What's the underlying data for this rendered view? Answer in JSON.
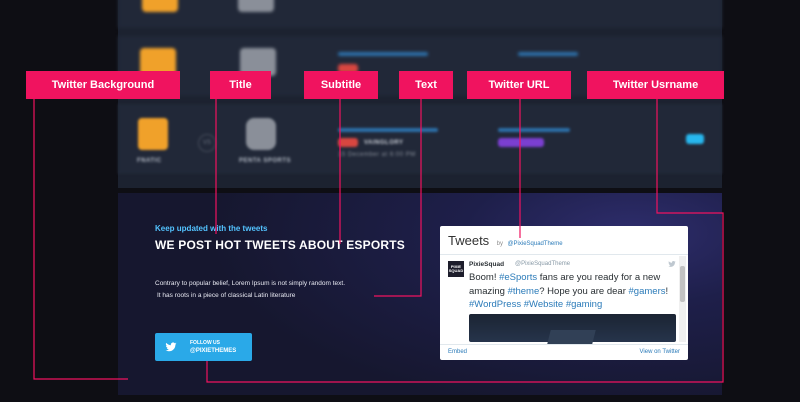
{
  "labels": {
    "twitter_background": "Twitter Background",
    "title": "Title",
    "subtitle": "Subtitle",
    "text": "Text",
    "twitter_url": "Twitter URL",
    "twitter_username": "Twitter Usrname"
  },
  "background_match": {
    "team_1": "FNATIC",
    "vs": "VS",
    "team_2": "PENTA SPORTS",
    "badge": "VAINGLORY",
    "date": "15 December at 6:00 PM"
  },
  "section": {
    "kicker": "Keep updated with the tweets",
    "headline": "WE POST HOT TWEETS ABOUT ESPORTS",
    "body_line_1": "Contrary to popular belief, Lorem Ipsum is not simply random text.",
    "body_line_2": "It has roots in a piece of classical Latin literature",
    "follow_label": "FOLLOW US",
    "follow_handle": "@PIXIETHEMES"
  },
  "widget": {
    "title": "Tweets",
    "by": "by",
    "handle": "@PixieSquadTheme",
    "tweet": {
      "avatar_text": "PIXIE SQUAD",
      "name": "PixieSquad",
      "screen_name": "@PixieSquadTheme",
      "t1": "Boom! ",
      "h1": "#eSports",
      "t2": " fans are you ready for a new amazing ",
      "h2": "#theme",
      "t3": "? Hope you are dear ",
      "h3": "#gamers",
      "t4": "! ",
      "h4": "#WordPress",
      "t5": " ",
      "h5": "#Website",
      "t6": " ",
      "h6": "#gaming"
    },
    "embed": "Embed",
    "view_on_twitter": "View on Twitter"
  },
  "colors": {
    "accent_pink": "#f0135f",
    "twitter_blue": "#2aa9e8",
    "kicker_blue": "#53c3ff",
    "link_blue": "#2b7bb9"
  },
  "icons": [
    "twitter-bird-icon"
  ]
}
